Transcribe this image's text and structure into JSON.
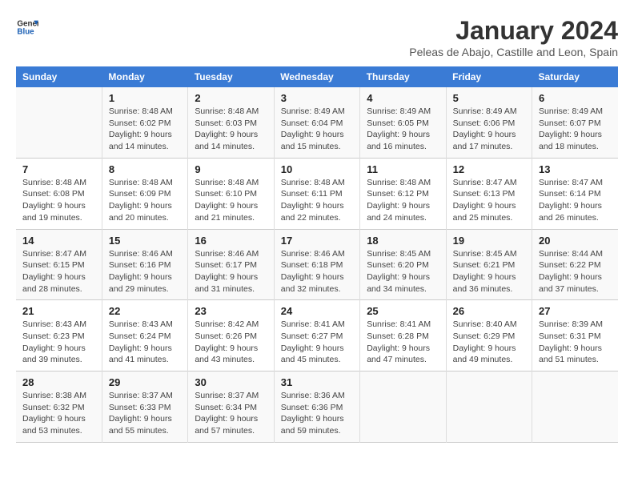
{
  "logo": {
    "line1": "General",
    "line2": "Blue"
  },
  "title": "January 2024",
  "subtitle": "Peleas de Abajo, Castille and Leon, Spain",
  "days_of_week": [
    "Sunday",
    "Monday",
    "Tuesday",
    "Wednesday",
    "Thursday",
    "Friday",
    "Saturday"
  ],
  "weeks": [
    [
      {
        "day": "",
        "sunrise": "",
        "sunset": "",
        "daylight": ""
      },
      {
        "day": "1",
        "sunrise": "Sunrise: 8:48 AM",
        "sunset": "Sunset: 6:02 PM",
        "daylight": "Daylight: 9 hours and 14 minutes."
      },
      {
        "day": "2",
        "sunrise": "Sunrise: 8:48 AM",
        "sunset": "Sunset: 6:03 PM",
        "daylight": "Daylight: 9 hours and 14 minutes."
      },
      {
        "day": "3",
        "sunrise": "Sunrise: 8:49 AM",
        "sunset": "Sunset: 6:04 PM",
        "daylight": "Daylight: 9 hours and 15 minutes."
      },
      {
        "day": "4",
        "sunrise": "Sunrise: 8:49 AM",
        "sunset": "Sunset: 6:05 PM",
        "daylight": "Daylight: 9 hours and 16 minutes."
      },
      {
        "day": "5",
        "sunrise": "Sunrise: 8:49 AM",
        "sunset": "Sunset: 6:06 PM",
        "daylight": "Daylight: 9 hours and 17 minutes."
      },
      {
        "day": "6",
        "sunrise": "Sunrise: 8:49 AM",
        "sunset": "Sunset: 6:07 PM",
        "daylight": "Daylight: 9 hours and 18 minutes."
      }
    ],
    [
      {
        "day": "7",
        "sunrise": "Sunrise: 8:48 AM",
        "sunset": "Sunset: 6:08 PM",
        "daylight": "Daylight: 9 hours and 19 minutes."
      },
      {
        "day": "8",
        "sunrise": "Sunrise: 8:48 AM",
        "sunset": "Sunset: 6:09 PM",
        "daylight": "Daylight: 9 hours and 20 minutes."
      },
      {
        "day": "9",
        "sunrise": "Sunrise: 8:48 AM",
        "sunset": "Sunset: 6:10 PM",
        "daylight": "Daylight: 9 hours and 21 minutes."
      },
      {
        "day": "10",
        "sunrise": "Sunrise: 8:48 AM",
        "sunset": "Sunset: 6:11 PM",
        "daylight": "Daylight: 9 hours and 22 minutes."
      },
      {
        "day": "11",
        "sunrise": "Sunrise: 8:48 AM",
        "sunset": "Sunset: 6:12 PM",
        "daylight": "Daylight: 9 hours and 24 minutes."
      },
      {
        "day": "12",
        "sunrise": "Sunrise: 8:47 AM",
        "sunset": "Sunset: 6:13 PM",
        "daylight": "Daylight: 9 hours and 25 minutes."
      },
      {
        "day": "13",
        "sunrise": "Sunrise: 8:47 AM",
        "sunset": "Sunset: 6:14 PM",
        "daylight": "Daylight: 9 hours and 26 minutes."
      }
    ],
    [
      {
        "day": "14",
        "sunrise": "Sunrise: 8:47 AM",
        "sunset": "Sunset: 6:15 PM",
        "daylight": "Daylight: 9 hours and 28 minutes."
      },
      {
        "day": "15",
        "sunrise": "Sunrise: 8:46 AM",
        "sunset": "Sunset: 6:16 PM",
        "daylight": "Daylight: 9 hours and 29 minutes."
      },
      {
        "day": "16",
        "sunrise": "Sunrise: 8:46 AM",
        "sunset": "Sunset: 6:17 PM",
        "daylight": "Daylight: 9 hours and 31 minutes."
      },
      {
        "day": "17",
        "sunrise": "Sunrise: 8:46 AM",
        "sunset": "Sunset: 6:18 PM",
        "daylight": "Daylight: 9 hours and 32 minutes."
      },
      {
        "day": "18",
        "sunrise": "Sunrise: 8:45 AM",
        "sunset": "Sunset: 6:20 PM",
        "daylight": "Daylight: 9 hours and 34 minutes."
      },
      {
        "day": "19",
        "sunrise": "Sunrise: 8:45 AM",
        "sunset": "Sunset: 6:21 PM",
        "daylight": "Daylight: 9 hours and 36 minutes."
      },
      {
        "day": "20",
        "sunrise": "Sunrise: 8:44 AM",
        "sunset": "Sunset: 6:22 PM",
        "daylight": "Daylight: 9 hours and 37 minutes."
      }
    ],
    [
      {
        "day": "21",
        "sunrise": "Sunrise: 8:43 AM",
        "sunset": "Sunset: 6:23 PM",
        "daylight": "Daylight: 9 hours and 39 minutes."
      },
      {
        "day": "22",
        "sunrise": "Sunrise: 8:43 AM",
        "sunset": "Sunset: 6:24 PM",
        "daylight": "Daylight: 9 hours and 41 minutes."
      },
      {
        "day": "23",
        "sunrise": "Sunrise: 8:42 AM",
        "sunset": "Sunset: 6:26 PM",
        "daylight": "Daylight: 9 hours and 43 minutes."
      },
      {
        "day": "24",
        "sunrise": "Sunrise: 8:41 AM",
        "sunset": "Sunset: 6:27 PM",
        "daylight": "Daylight: 9 hours and 45 minutes."
      },
      {
        "day": "25",
        "sunrise": "Sunrise: 8:41 AM",
        "sunset": "Sunset: 6:28 PM",
        "daylight": "Daylight: 9 hours and 47 minutes."
      },
      {
        "day": "26",
        "sunrise": "Sunrise: 8:40 AM",
        "sunset": "Sunset: 6:29 PM",
        "daylight": "Daylight: 9 hours and 49 minutes."
      },
      {
        "day": "27",
        "sunrise": "Sunrise: 8:39 AM",
        "sunset": "Sunset: 6:31 PM",
        "daylight": "Daylight: 9 hours and 51 minutes."
      }
    ],
    [
      {
        "day": "28",
        "sunrise": "Sunrise: 8:38 AM",
        "sunset": "Sunset: 6:32 PM",
        "daylight": "Daylight: 9 hours and 53 minutes."
      },
      {
        "day": "29",
        "sunrise": "Sunrise: 8:37 AM",
        "sunset": "Sunset: 6:33 PM",
        "daylight": "Daylight: 9 hours and 55 minutes."
      },
      {
        "day": "30",
        "sunrise": "Sunrise: 8:37 AM",
        "sunset": "Sunset: 6:34 PM",
        "daylight": "Daylight: 9 hours and 57 minutes."
      },
      {
        "day": "31",
        "sunrise": "Sunrise: 8:36 AM",
        "sunset": "Sunset: 6:36 PM",
        "daylight": "Daylight: 9 hours and 59 minutes."
      },
      {
        "day": "",
        "sunrise": "",
        "sunset": "",
        "daylight": ""
      },
      {
        "day": "",
        "sunrise": "",
        "sunset": "",
        "daylight": ""
      },
      {
        "day": "",
        "sunrise": "",
        "sunset": "",
        "daylight": ""
      }
    ]
  ]
}
